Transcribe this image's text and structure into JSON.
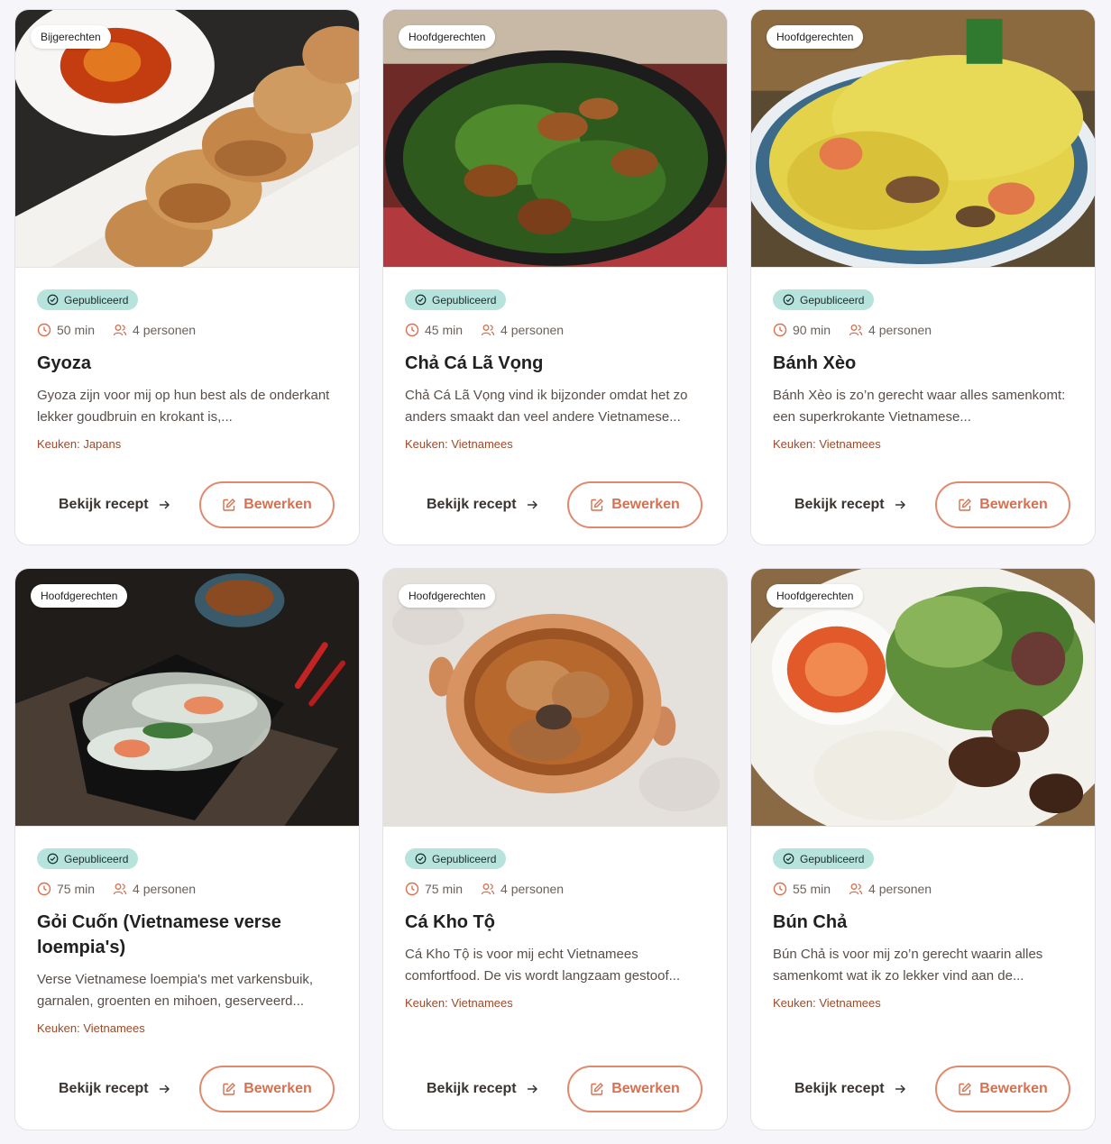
{
  "recipes": [
    {
      "category": "Bijgerechten",
      "status": "Gepubliceerd",
      "time": "50 min",
      "servings": "4 personen",
      "title": "Gyoza",
      "description": "Gyoza zijn voor mij op hun best als de onderkant lekker goudbruin en krokant is,...",
      "cuisine": "Keuken: Japans",
      "view_label": "Bekijk recept",
      "edit_label": "Bewerken",
      "image_icon": "gyoza-photo"
    },
    {
      "category": "Hoofdgerechten",
      "status": "Gepubliceerd",
      "time": "45 min",
      "servings": "4 personen",
      "title": "Chả Cá Lã Vọng",
      "description": "Chả Cá Lã Vọng vind ik bijzonder omdat het zo anders smaakt dan veel andere Vietnamese...",
      "cuisine": "Keuken: Vietnamees",
      "view_label": "Bekijk recept",
      "edit_label": "Bewerken",
      "image_icon": "cha-ca-photo"
    },
    {
      "category": "Hoofdgerechten",
      "status": "Gepubliceerd",
      "time": "90 min",
      "servings": "4 personen",
      "title": "Bánh Xèo",
      "description": "Bánh Xèo is zo’n gerecht waar alles samenkomt: een superkrokante Vietnamese...",
      "cuisine": "Keuken: Vietnamees",
      "view_label": "Bekijk recept",
      "edit_label": "Bewerken",
      "image_icon": "banh-xeo-photo"
    },
    {
      "category": "Hoofdgerechten",
      "status": "Gepubliceerd",
      "time": "75 min",
      "servings": "4 personen",
      "title": "Gỏi Cuốn (Vietnamese verse loempia's)",
      "description": "Verse Vietnamese loempia's met varkensbuik, garnalen, groenten en mihoen, geserveerd...",
      "cuisine": "Keuken: Vietnamees",
      "view_label": "Bekijk recept",
      "edit_label": "Bewerken",
      "image_icon": "goi-cuon-photo"
    },
    {
      "category": "Hoofdgerechten",
      "status": "Gepubliceerd",
      "time": "75 min",
      "servings": "4 personen",
      "title": "Cá Kho Tộ",
      "description": "Cá Kho Tộ is voor mij echt Vietnamees comfortfood. De vis wordt langzaam gestoof...",
      "cuisine": "Keuken: Vietnamees",
      "view_label": "Bekijk recept",
      "edit_label": "Bewerken",
      "image_icon": "ca-kho-to-photo"
    },
    {
      "category": "Hoofdgerechten",
      "status": "Gepubliceerd",
      "time": "55 min",
      "servings": "4 personen",
      "title": "Bún Chả",
      "description": "Bún Chả is voor mij zo’n gerecht waarin alles samenkomt wat ik zo lekker vind aan de...",
      "cuisine": "Keuken: Vietnamees",
      "view_label": "Bekijk recept",
      "edit_label": "Bewerken",
      "image_icon": "bun-cha-photo"
    }
  ],
  "colors": {
    "accent": "#d8704f",
    "badge_bg": "#b6e4dd",
    "cuisine_text": "#9b4a2a"
  }
}
